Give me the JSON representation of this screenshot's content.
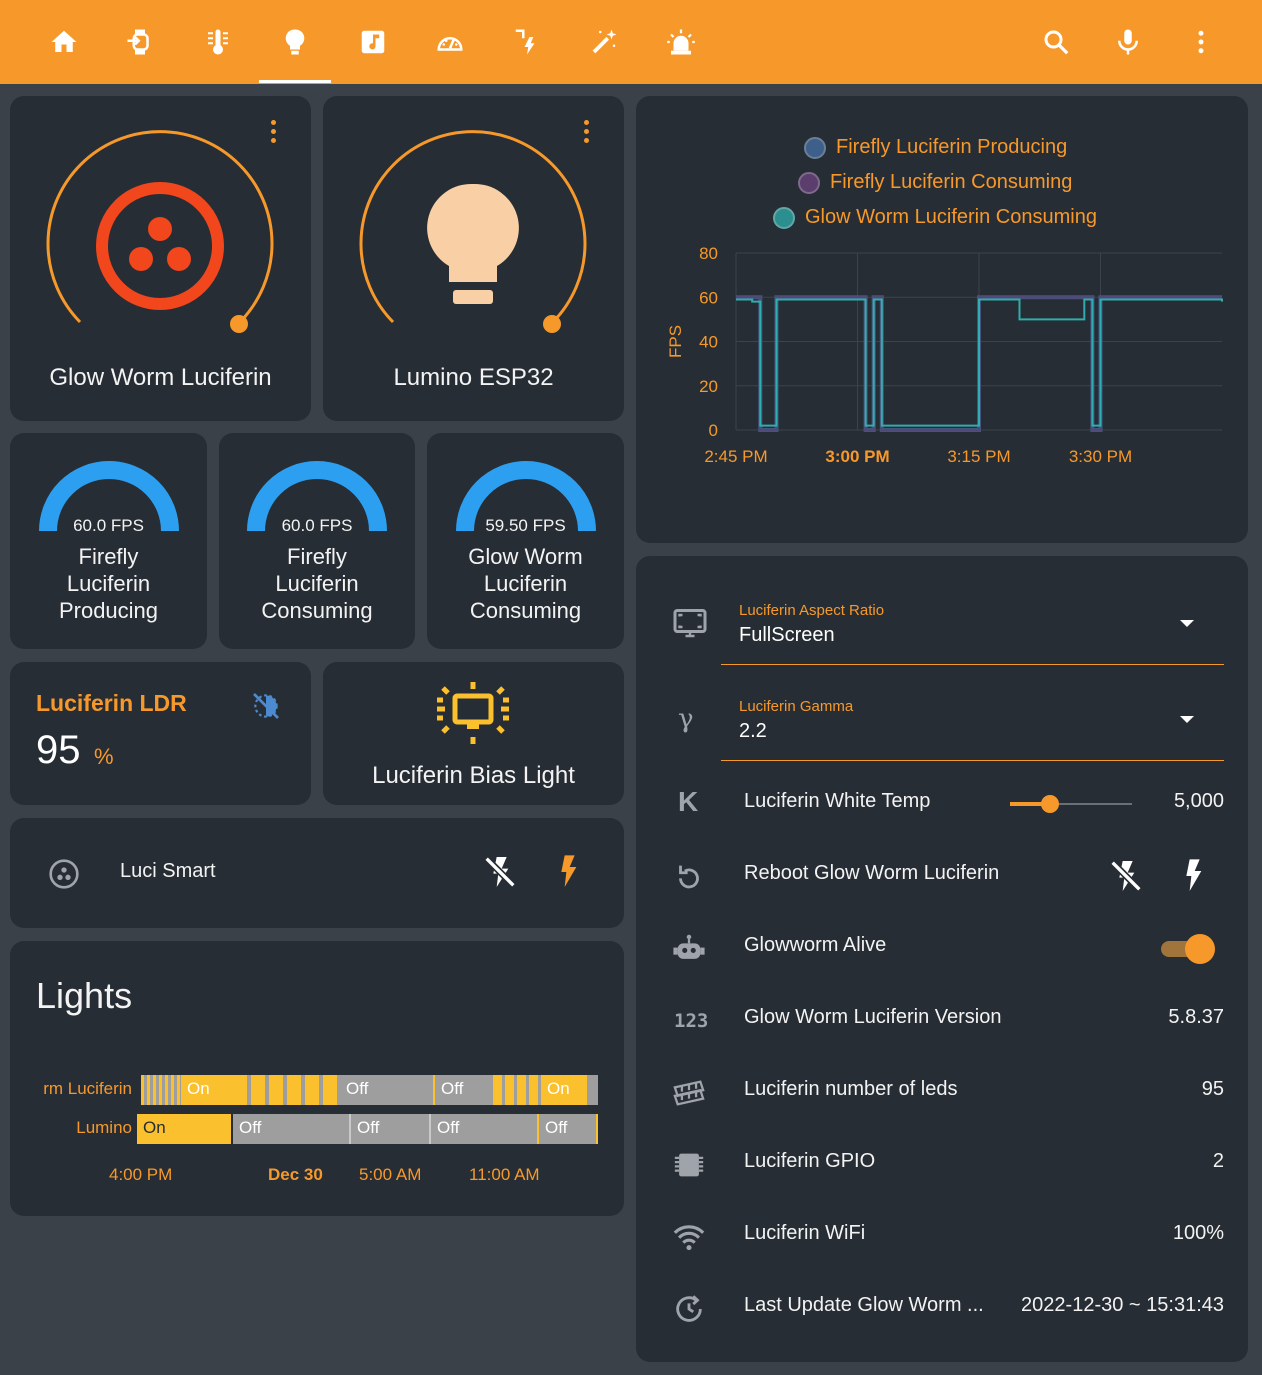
{
  "colors": {
    "accent": "#f7992a",
    "card": "#272d34",
    "background": "#3a4148",
    "gauge_blue": "#2d9ff0",
    "on_yellow": "#fbc02d",
    "off_grey": "#9e9e9e",
    "series_producing": "#3e5f8a",
    "series_consuming": "#5b3d6e",
    "series_glowworm": "#2fb3b2"
  },
  "toolbar": {
    "tabs": [
      {
        "icon": "home-icon"
      },
      {
        "icon": "watch-import-icon"
      },
      {
        "icon": "thermometer-icon"
      },
      {
        "icon": "lightbulb-icon",
        "active": true
      },
      {
        "icon": "music-note-icon"
      },
      {
        "icon": "speedometer-icon"
      },
      {
        "icon": "flash-auto-icon"
      },
      {
        "icon": "magic-wand-icon"
      },
      {
        "icon": "alarm-light-icon"
      }
    ],
    "search_icon": "search-icon",
    "mic_icon": "microphone-icon",
    "menu_icon": "more-vertical-icon"
  },
  "light_tiles": [
    {
      "name": "Glow Worm Luciferin",
      "icon": "luciferin-logo-icon",
      "brightness": 0.85
    },
    {
      "name": "Lumino ESP32",
      "icon": "lightbulb-icon",
      "brightness": 0.85
    }
  ],
  "gauges": [
    {
      "value_label": "60.0 FPS",
      "value": 60.0,
      "max": 60,
      "name_lines": [
        "Firefly",
        "Luciferin",
        "Producing"
      ]
    },
    {
      "value_label": "60.0 FPS",
      "value": 60.0,
      "max": 60,
      "name_lines": [
        "Firefly",
        "Luciferin",
        "Consuming"
      ]
    },
    {
      "value_label": "59.50 FPS",
      "value": 59.5,
      "max": 60,
      "name_lines": [
        "Glow Worm",
        "Luciferin",
        "Consuming"
      ]
    }
  ],
  "ldr": {
    "name": "Luciferin LDR",
    "value": "95",
    "unit": "%",
    "icon": "brightness-auto-icon"
  },
  "bias_light": {
    "name": "Luciferin Bias Light",
    "icon": "monitor-light-icon"
  },
  "luci_smart": {
    "name": "Luci Smart",
    "icon": "luciferin-logo-icon",
    "off_icon": "flash-off-icon",
    "on_icon": "flash-icon"
  },
  "lights_history": {
    "title": "Lights",
    "rows": [
      {
        "label": "rm Luciferin",
        "segments": [
          "On",
          "Off",
          "Off",
          "On"
        ]
      },
      {
        "label": "Lumino",
        "segments": [
          "On",
          "Off",
          "Off",
          "Off",
          "Off"
        ]
      }
    ],
    "axis": [
      "4:00 PM",
      "Dec 30",
      "5:00 AM",
      "11:00 AM"
    ]
  },
  "chart_data": {
    "type": "line",
    "title": "",
    "xlabel": "",
    "ylabel": "FPS",
    "ylim": [
      0,
      80
    ],
    "yticks": [
      "0",
      "20",
      "40",
      "60",
      "80"
    ],
    "xticks": [
      "2:45 PM",
      "3:00 PM",
      "3:15 PM",
      "3:30 PM"
    ],
    "legend_placement": "top",
    "series": [
      {
        "name": "Firefly Luciferin Producing",
        "x": [
          "2:45",
          "2:47",
          "2:48",
          "2:50",
          "3:00",
          "3:01",
          "3:02",
          "3:03",
          "3:15",
          "3:20",
          "3:28",
          "3:29",
          "3:30",
          "3:45"
        ],
        "values": [
          60,
          60,
          0,
          60,
          60,
          0,
          60,
          0,
          60,
          60,
          60,
          0,
          60,
          60
        ]
      },
      {
        "name": "Firefly Luciferin Consuming",
        "x": [
          "2:45",
          "2:47",
          "2:48",
          "2:50",
          "3:00",
          "3:01",
          "3:02",
          "3:03",
          "3:15",
          "3:20",
          "3:28",
          "3:29",
          "3:30",
          "3:45"
        ],
        "values": [
          60,
          60,
          0,
          60,
          60,
          0,
          60,
          0,
          60,
          60,
          60,
          0,
          60,
          60
        ]
      },
      {
        "name": "Glow Worm Luciferin Consuming",
        "x": [
          "2:45",
          "2:47",
          "2:48",
          "2:50",
          "3:00",
          "3:01",
          "3:02",
          "3:03",
          "3:15",
          "3:20",
          "3:28",
          "3:29",
          "3:30",
          "3:45"
        ],
        "values": [
          59,
          58,
          2,
          59,
          59,
          2,
          59,
          2,
          59,
          50,
          59,
          2,
          59,
          58
        ]
      }
    ]
  },
  "selects": [
    {
      "label": "Luciferin Aspect Ratio",
      "value": "FullScreen",
      "icon": "monitor-screenshot-icon"
    },
    {
      "label": "Luciferin Gamma",
      "value": "2.2",
      "icon": "gamma-icon"
    }
  ],
  "entities": [
    {
      "name": "Luciferin White Temp",
      "value": "5,000",
      "icon": "kelvin-icon",
      "slider": 0.33
    },
    {
      "name": "Reboot Glow Worm Luciferin",
      "icon": "restart-icon"
    },
    {
      "name": "Glowworm Alive",
      "icon": "robot-icon",
      "toggle": true
    },
    {
      "name": "Glow Worm Luciferin Version",
      "value": "5.8.37",
      "icon": "numeric-icon",
      "icon_text": "123"
    },
    {
      "name": "Luciferin number of leds",
      "value": "95",
      "icon": "led-strip-icon"
    },
    {
      "name": "Luciferin GPIO",
      "value": "2",
      "icon": "chip-icon"
    },
    {
      "name": "Luciferin WiFi",
      "value": "100%",
      "icon": "wifi-icon"
    },
    {
      "name": "Last Update Glow Worm ...",
      "value": "2022-12-30 ~ 15:31:43",
      "icon": "update-icon"
    }
  ]
}
